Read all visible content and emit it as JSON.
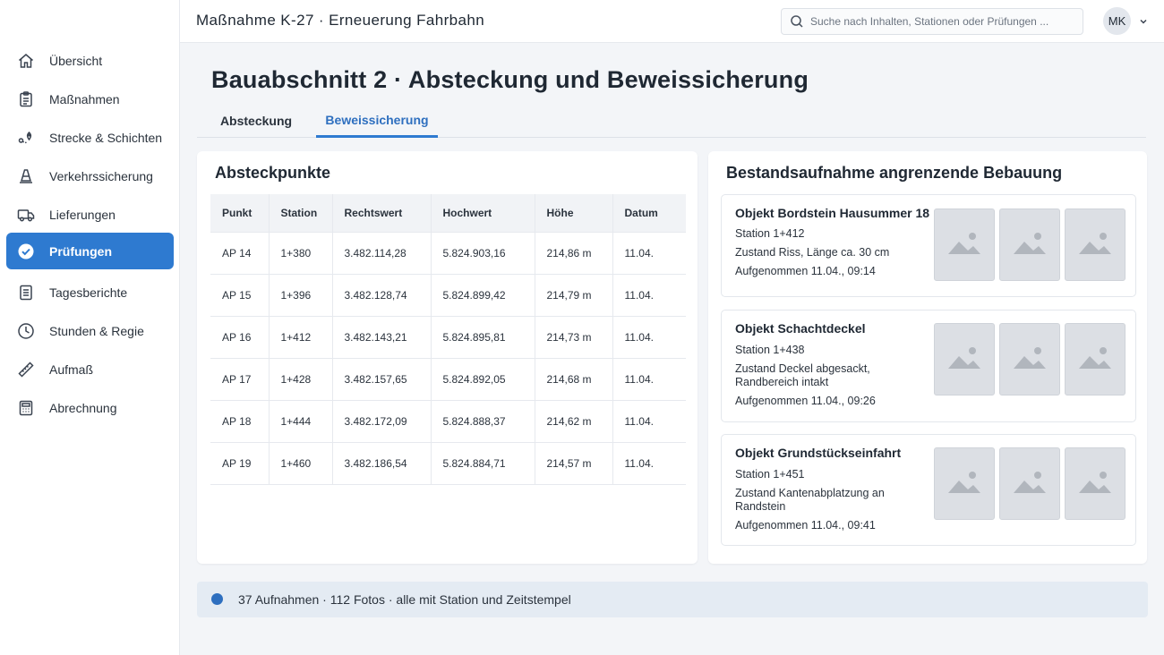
{
  "header": {
    "title": "Maßnahme K-27 · Erneuerung Fahrbahn",
    "search_placeholder": "Suche nach Inhalten, Stationen oder Prüfungen ...",
    "avatar_initials": "MK"
  },
  "sidebar": {
    "items": [
      {
        "label": "Übersicht",
        "icon": "home-icon"
      },
      {
        "label": "Maßnahmen",
        "icon": "clipboard-icon"
      },
      {
        "label": "Strecke & Schichten",
        "icon": "route-icon"
      },
      {
        "label": "Verkehrssicherung",
        "icon": "traffic-cone-icon"
      },
      {
        "label": "Lieferungen",
        "icon": "truck-icon"
      },
      {
        "label": "Prüfungen",
        "icon": "check-circle-icon",
        "active": true
      },
      {
        "label": "Tagesberichte",
        "icon": "report-icon"
      },
      {
        "label": "Stunden & Regie",
        "icon": "clock-icon"
      },
      {
        "label": "Aufmaß",
        "icon": "ruler-icon"
      },
      {
        "label": "Abrechnung",
        "icon": "calculator-icon"
      }
    ]
  },
  "page": {
    "title": "Bauabschnitt 2 · Absteckung und Beweissicherung",
    "tabs": [
      {
        "label": "Absteckung",
        "active": false
      },
      {
        "label": "Beweissicherung",
        "active": true
      }
    ]
  },
  "points": {
    "title": "Absteckpunkte",
    "columns": [
      "Punkt",
      "Station",
      "Rechtswert",
      "Hochwert",
      "Höhe",
      "Datum"
    ],
    "rows": [
      [
        "AP 14",
        "1+380",
        "3.482.114,28",
        "5.824.903,16",
        "214,86 m",
        "11.04."
      ],
      [
        "AP 15",
        "1+396",
        "3.482.128,74",
        "5.824.899,42",
        "214,79 m",
        "11.04."
      ],
      [
        "AP 16",
        "1+412",
        "3.482.143,21",
        "5.824.895,81",
        "214,73 m",
        "11.04."
      ],
      [
        "AP 17",
        "1+428",
        "3.482.157,65",
        "5.824.892,05",
        "214,68 m",
        "11.04."
      ],
      [
        "AP 18",
        "1+444",
        "3.482.172,09",
        "5.824.888,37",
        "214,62 m",
        "11.04."
      ],
      [
        "AP 19",
        "1+460",
        "3.482.186,54",
        "5.824.884,71",
        "214,57 m",
        "11.04."
      ]
    ]
  },
  "survey": {
    "title": "Bestandsaufnahme angrenzende Bebauung",
    "objects": [
      {
        "title": "Objekt Bordstein Hausummer 18",
        "station": "Station  1+412",
        "condition": "Zustand Riss, Länge ca. 30 cm",
        "recorded": "Aufgenommen 11.04., 09:14"
      },
      {
        "title": "Objekt Schachtdeckel",
        "station": "Station  1+438",
        "condition": "Zustand Deckel abgesackt, Randbereich intakt",
        "recorded": "Aufgenommen 11.04., 09:26"
      },
      {
        "title": "Objekt Grundstückseinfahrt",
        "station": "Station  1+451",
        "condition": "Zustand Kantenabplatzung an Randstein",
        "recorded": "Aufgenommen 11.04., 09:41"
      }
    ]
  },
  "footer": {
    "text": "37 Aufnahmen · 112 Fotos · alle mit Station und Zeitstempel"
  },
  "colors": {
    "accent": "#2e7ad0",
    "accent_dark": "#2e6fbf",
    "footer_bg": "#e4ebf3"
  }
}
